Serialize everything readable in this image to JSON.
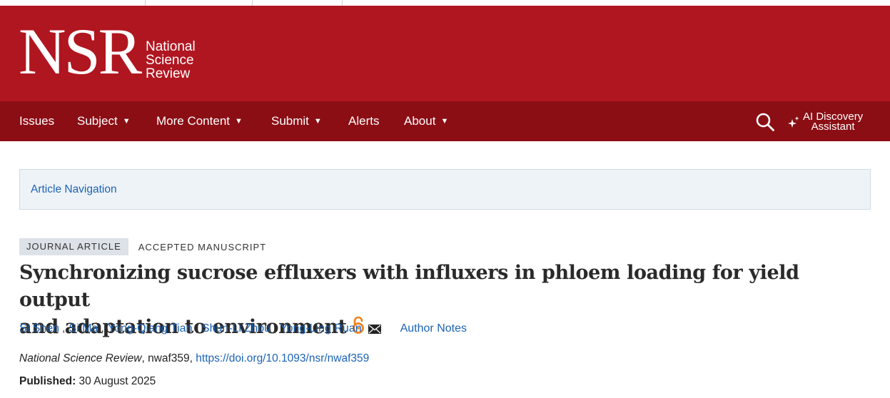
{
  "brand": {
    "logo_letters": "NSR",
    "logo_words": [
      "National",
      "Science",
      "Review"
    ],
    "background": "#b01620"
  },
  "nav": {
    "background": "#8b0e14",
    "items": [
      {
        "label": "Issues",
        "dropdown": false
      },
      {
        "label": "Subject",
        "dropdown": true
      },
      {
        "label": "More Content",
        "dropdown": true
      },
      {
        "label": "Submit",
        "dropdown": true
      },
      {
        "label": "Alerts",
        "dropdown": false
      },
      {
        "label": "About",
        "dropdown": true
      }
    ],
    "caret": "▼",
    "search_icon": "search-icon",
    "ai_assistant": {
      "line1": "AI Discovery",
      "line2": "Assistant",
      "icon": "sparkle-icon"
    }
  },
  "article_nav": {
    "label": "Article Navigation"
  },
  "badges": {
    "journal": "JOURNAL ARTICLE",
    "status": "ACCEPTED MANUSCRIPT"
  },
  "article": {
    "title_line1": "Synchronizing sucrose effluxers with influxers in phloem loading for yield output",
    "title_line2": "and adaptation to environment",
    "open_access_icon": "open-access-icon",
    "open_access_color": "#f0821e",
    "authors": [
      "Si Shen",
      "Si Ma",
      "Yong-Qiang Tian",
      "Shun-Li Zhou",
      "Yong-Ling Ruan"
    ],
    "author_separator": ",",
    "email_icon": "envelope-icon",
    "author_notes": "Author Notes",
    "journal": "National Science Review",
    "article_id": ", nwaf359, ",
    "doi": "https://doi.org/10.1093/nsr/nwaf359",
    "published_label": "Published:",
    "published_date": "30 August 2025"
  },
  "colors": {
    "link": "#1b63b5",
    "badge_bg": "#dde2e8",
    "nav_box_bg": "#eef3f8"
  }
}
